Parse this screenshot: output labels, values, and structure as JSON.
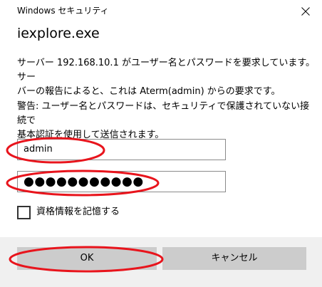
{
  "window": {
    "title": "Windows セキュリティ",
    "app_name": "iexplore.exe"
  },
  "prompt": {
    "message": "サーバー 192.168.10.1 がユーザー名とパスワードを要求しています。サー\nバーの報告によると、これは Aterm(admin) からの要求です。",
    "warning": "警告: ユーザー名とパスワードは、セキュリティで保護されていない接続で\n基本認証を使用して送信されます。"
  },
  "form": {
    "username_value": "admin",
    "password_masked": "●●●●●●●●●●●",
    "remember_label": "資格情報を記憶する",
    "remember_checked": false
  },
  "buttons": {
    "ok_label": "OK",
    "cancel_label": "キャンセル"
  },
  "icons": {
    "close": "close-icon"
  },
  "colors": {
    "annotation_red": "#e8141c",
    "button_gray": "#cccccc",
    "footer_gray": "#f0f0f0"
  }
}
